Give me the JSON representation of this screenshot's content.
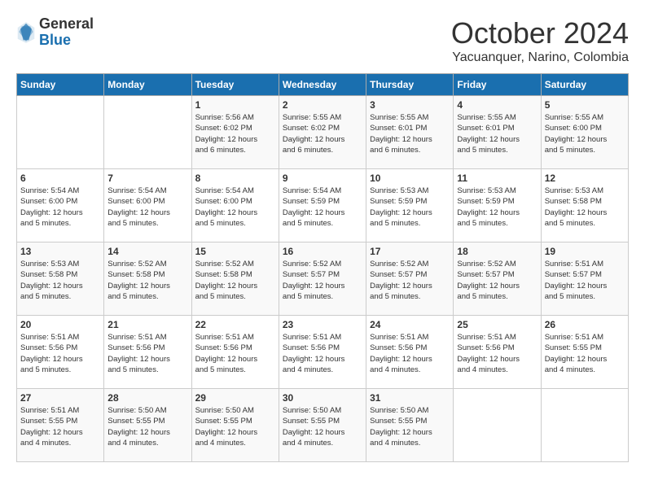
{
  "header": {
    "logo_general": "General",
    "logo_blue": "Blue",
    "month": "October 2024",
    "location": "Yacuanquer, Narino, Colombia"
  },
  "days_of_week": [
    "Sunday",
    "Monday",
    "Tuesday",
    "Wednesday",
    "Thursday",
    "Friday",
    "Saturday"
  ],
  "weeks": [
    [
      {
        "num": "",
        "info": ""
      },
      {
        "num": "",
        "info": ""
      },
      {
        "num": "1",
        "info": "Sunrise: 5:56 AM\nSunset: 6:02 PM\nDaylight: 12 hours\nand 6 minutes."
      },
      {
        "num": "2",
        "info": "Sunrise: 5:55 AM\nSunset: 6:02 PM\nDaylight: 12 hours\nand 6 minutes."
      },
      {
        "num": "3",
        "info": "Sunrise: 5:55 AM\nSunset: 6:01 PM\nDaylight: 12 hours\nand 6 minutes."
      },
      {
        "num": "4",
        "info": "Sunrise: 5:55 AM\nSunset: 6:01 PM\nDaylight: 12 hours\nand 5 minutes."
      },
      {
        "num": "5",
        "info": "Sunrise: 5:55 AM\nSunset: 6:00 PM\nDaylight: 12 hours\nand 5 minutes."
      }
    ],
    [
      {
        "num": "6",
        "info": "Sunrise: 5:54 AM\nSunset: 6:00 PM\nDaylight: 12 hours\nand 5 minutes."
      },
      {
        "num": "7",
        "info": "Sunrise: 5:54 AM\nSunset: 6:00 PM\nDaylight: 12 hours\nand 5 minutes."
      },
      {
        "num": "8",
        "info": "Sunrise: 5:54 AM\nSunset: 6:00 PM\nDaylight: 12 hours\nand 5 minutes."
      },
      {
        "num": "9",
        "info": "Sunrise: 5:54 AM\nSunset: 5:59 PM\nDaylight: 12 hours\nand 5 minutes."
      },
      {
        "num": "10",
        "info": "Sunrise: 5:53 AM\nSunset: 5:59 PM\nDaylight: 12 hours\nand 5 minutes."
      },
      {
        "num": "11",
        "info": "Sunrise: 5:53 AM\nSunset: 5:59 PM\nDaylight: 12 hours\nand 5 minutes."
      },
      {
        "num": "12",
        "info": "Sunrise: 5:53 AM\nSunset: 5:58 PM\nDaylight: 12 hours\nand 5 minutes."
      }
    ],
    [
      {
        "num": "13",
        "info": "Sunrise: 5:53 AM\nSunset: 5:58 PM\nDaylight: 12 hours\nand 5 minutes."
      },
      {
        "num": "14",
        "info": "Sunrise: 5:52 AM\nSunset: 5:58 PM\nDaylight: 12 hours\nand 5 minutes."
      },
      {
        "num": "15",
        "info": "Sunrise: 5:52 AM\nSunset: 5:58 PM\nDaylight: 12 hours\nand 5 minutes."
      },
      {
        "num": "16",
        "info": "Sunrise: 5:52 AM\nSunset: 5:57 PM\nDaylight: 12 hours\nand 5 minutes."
      },
      {
        "num": "17",
        "info": "Sunrise: 5:52 AM\nSunset: 5:57 PM\nDaylight: 12 hours\nand 5 minutes."
      },
      {
        "num": "18",
        "info": "Sunrise: 5:52 AM\nSunset: 5:57 PM\nDaylight: 12 hours\nand 5 minutes."
      },
      {
        "num": "19",
        "info": "Sunrise: 5:51 AM\nSunset: 5:57 PM\nDaylight: 12 hours\nand 5 minutes."
      }
    ],
    [
      {
        "num": "20",
        "info": "Sunrise: 5:51 AM\nSunset: 5:56 PM\nDaylight: 12 hours\nand 5 minutes."
      },
      {
        "num": "21",
        "info": "Sunrise: 5:51 AM\nSunset: 5:56 PM\nDaylight: 12 hours\nand 5 minutes."
      },
      {
        "num": "22",
        "info": "Sunrise: 5:51 AM\nSunset: 5:56 PM\nDaylight: 12 hours\nand 5 minutes."
      },
      {
        "num": "23",
        "info": "Sunrise: 5:51 AM\nSunset: 5:56 PM\nDaylight: 12 hours\nand 4 minutes."
      },
      {
        "num": "24",
        "info": "Sunrise: 5:51 AM\nSunset: 5:56 PM\nDaylight: 12 hours\nand 4 minutes."
      },
      {
        "num": "25",
        "info": "Sunrise: 5:51 AM\nSunset: 5:56 PM\nDaylight: 12 hours\nand 4 minutes."
      },
      {
        "num": "26",
        "info": "Sunrise: 5:51 AM\nSunset: 5:55 PM\nDaylight: 12 hours\nand 4 minutes."
      }
    ],
    [
      {
        "num": "27",
        "info": "Sunrise: 5:51 AM\nSunset: 5:55 PM\nDaylight: 12 hours\nand 4 minutes."
      },
      {
        "num": "28",
        "info": "Sunrise: 5:50 AM\nSunset: 5:55 PM\nDaylight: 12 hours\nand 4 minutes."
      },
      {
        "num": "29",
        "info": "Sunrise: 5:50 AM\nSunset: 5:55 PM\nDaylight: 12 hours\nand 4 minutes."
      },
      {
        "num": "30",
        "info": "Sunrise: 5:50 AM\nSunset: 5:55 PM\nDaylight: 12 hours\nand 4 minutes."
      },
      {
        "num": "31",
        "info": "Sunrise: 5:50 AM\nSunset: 5:55 PM\nDaylight: 12 hours\nand 4 minutes."
      },
      {
        "num": "",
        "info": ""
      },
      {
        "num": "",
        "info": ""
      }
    ]
  ]
}
